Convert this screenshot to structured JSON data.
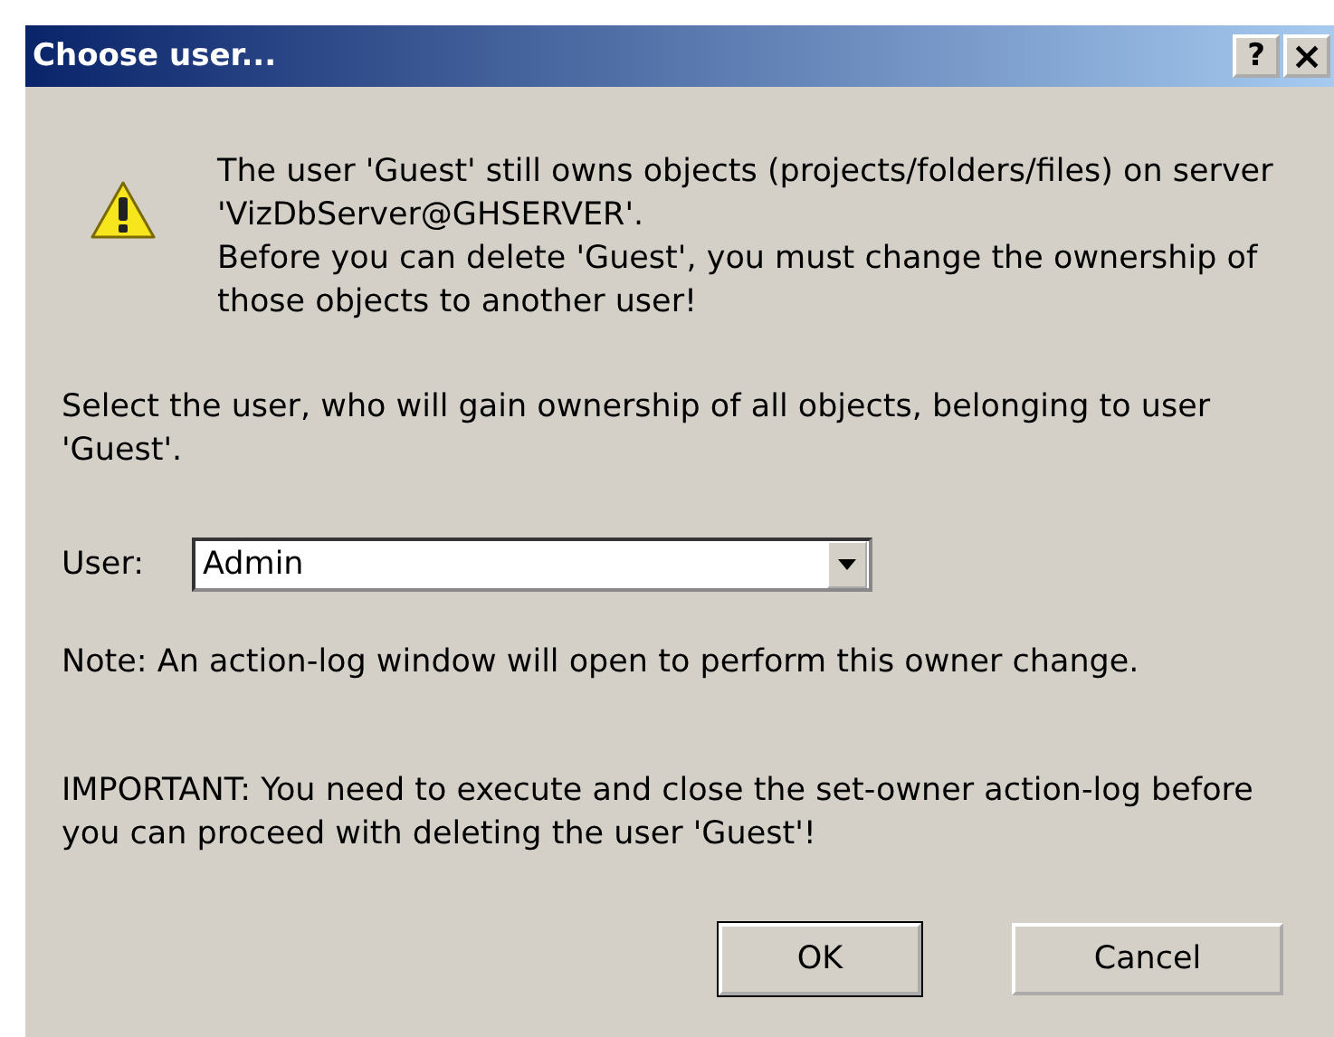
{
  "window": {
    "title": "Choose user...",
    "title_buttons": [
      {
        "kind": "help",
        "label": "?"
      },
      {
        "kind": "close",
        "label": "×"
      }
    ]
  },
  "message": [
    "The user 'Guest' still owns objects (projects/folders/files) on server 'VizDbServer@GHSERVER'.",
    "Before you can delete 'Guest', you must change the ownership of those objects to another user!"
  ],
  "instruction": "Select the user, who will gain ownership of all objects, belonging to user 'Guest'.",
  "user_field": {
    "label": "User:",
    "value": "Admin"
  },
  "note": "Note: An action-log window will open to perform this owner change.",
  "important": "IMPORTANT: You need to execute and close the set-owner action-log before you can proceed with deleting the user 'Guest'!",
  "buttons": [
    {
      "label": "OK",
      "default": true
    },
    {
      "label": "Cancel",
      "default": false
    }
  ]
}
